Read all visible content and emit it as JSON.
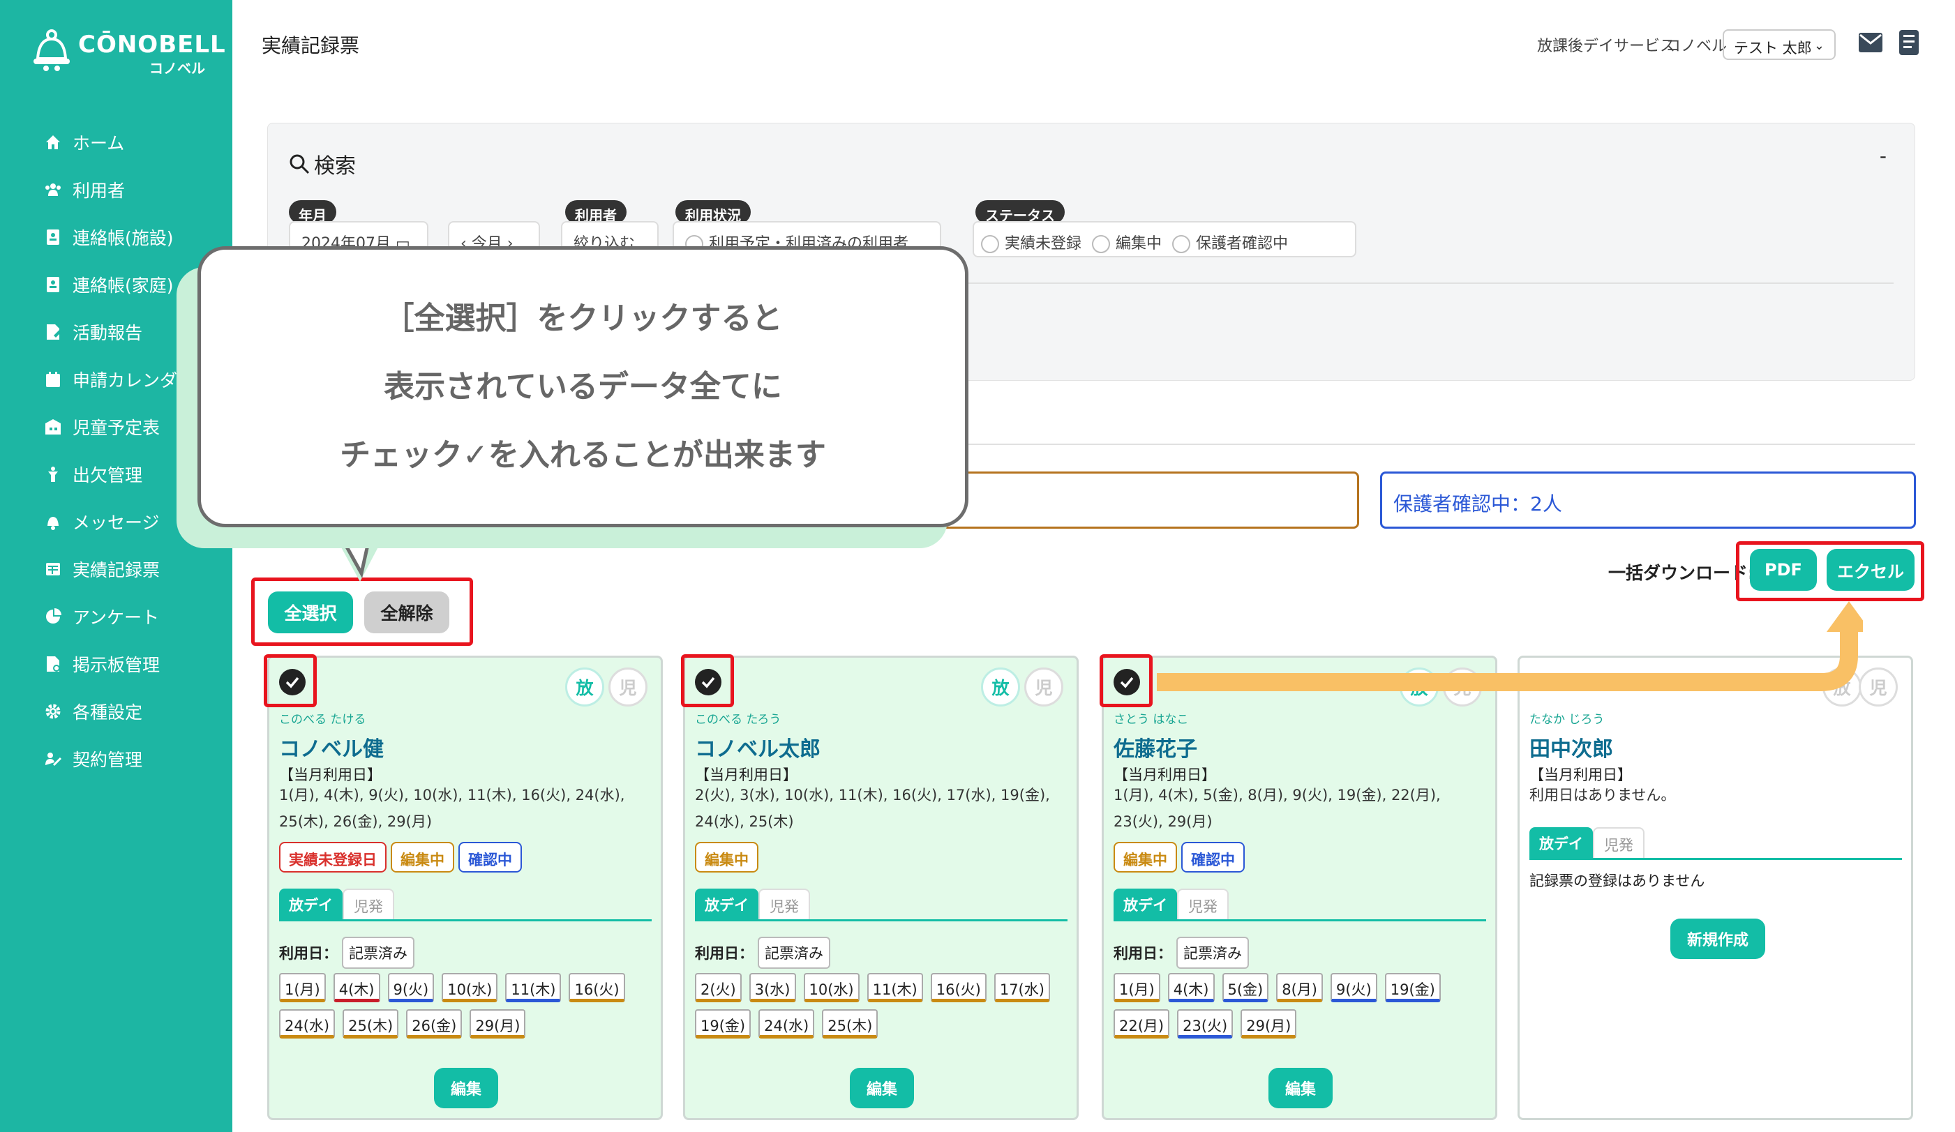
{
  "brand": {
    "name": "CŌNOBELL",
    "sub": "コノベル"
  },
  "sidebar": {
    "items": [
      {
        "label": "ホーム",
        "icon": "home-icon"
      },
      {
        "label": "利用者",
        "icon": "users-icon"
      },
      {
        "label": "連絡帳(施設)",
        "icon": "contact-book-icon"
      },
      {
        "label": "連絡帳(家庭)",
        "icon": "contact-book-icon"
      },
      {
        "label": "活動報告",
        "icon": "report-icon"
      },
      {
        "label": "申請カレンダー",
        "icon": "calendar-icon"
      },
      {
        "label": "児童予定表",
        "icon": "schedule-icon"
      },
      {
        "label": "出欠管理",
        "icon": "attendance-icon"
      },
      {
        "label": "メッセージ",
        "icon": "bell-icon"
      },
      {
        "label": "実績記録票",
        "icon": "table-icon"
      },
      {
        "label": "アンケート",
        "icon": "pie-icon"
      },
      {
        "label": "掲示板管理",
        "icon": "board-icon"
      },
      {
        "label": "各種設定",
        "icon": "gear-icon"
      },
      {
        "label": "契約管理",
        "icon": "contract-icon"
      }
    ]
  },
  "header": {
    "title": "実績記録票",
    "service": "放課後デイサービス",
    "facility": "コノベル",
    "user": "テスト 太郎"
  },
  "search": {
    "title": "検索",
    "collapse": "-",
    "year_month_label": "年月",
    "year_month_value": "2024年07月",
    "month_nav": "今月",
    "user_label": "利用者",
    "user_value": "絞り込む",
    "usage_label": "利用状況",
    "usage_value": "利用予定・利用済みの利用者",
    "status_label": "ステータス",
    "status_options": [
      "実績未登録",
      "編集中",
      "保護者確認中"
    ]
  },
  "status_summary": {
    "confirm": "保護者確認中：2人"
  },
  "download": {
    "label": "一括ダウンロード:",
    "pdf": "PDF",
    "excel": "エクセル"
  },
  "select": {
    "all": "全選択",
    "none": "全解除"
  },
  "callout": {
    "lines": [
      "［全選択］をクリックすると",
      "表示されているデータ全てに",
      "チェック✓を入れることが出来ます"
    ]
  },
  "common": {
    "badge_hou": "放",
    "badge_ji": "児",
    "usage_label": "【当月利用日】",
    "tab_hou": "放デイ",
    "tab_ji": "児発",
    "use_date": "利用日：",
    "recorded": "記票済み",
    "edit": "編集",
    "new": "新規作成"
  },
  "cards": [
    {
      "kana": "このべる たける",
      "name": "コノベル健",
      "days_text": "1(月), 4(木), 9(火), 10(水), 11(木), 16(火), 24(水), 25(木), 26(金), 29(月)",
      "tags": [
        {
          "label": "実績未登録日",
          "color": "#d9302c"
        },
        {
          "label": "編集中",
          "color": "#c98a12"
        },
        {
          "label": "確認中",
          "color": "#2b58d6"
        }
      ],
      "days": [
        {
          "label": "1(月)",
          "color": "#c98a12"
        },
        {
          "label": "4(木)",
          "color": "#c81e2a"
        },
        {
          "label": "9(火)",
          "color": "#2b58d6"
        },
        {
          "label": "10(水)",
          "color": "#c98a12"
        },
        {
          "label": "11(木)",
          "color": "#2b58d6"
        },
        {
          "label": "16(火)",
          "color": "#c98a12"
        },
        {
          "label": "24(水)",
          "color": "#c98a12"
        },
        {
          "label": "25(木)",
          "color": "#c98a12"
        },
        {
          "label": "26(金)",
          "color": "#c98a12"
        },
        {
          "label": "29(月)",
          "color": "#c98a12"
        }
      ]
    },
    {
      "kana": "このべる たろう",
      "name": "コノベル太郎",
      "days_text": "2(火), 3(水), 10(水), 11(木), 16(火), 17(水), 19(金), 24(水), 25(木)",
      "tags": [
        {
          "label": "編集中",
          "color": "#c98a12"
        }
      ],
      "days": [
        {
          "label": "2(火)",
          "color": "#c98a12"
        },
        {
          "label": "3(水)",
          "color": "#c98a12"
        },
        {
          "label": "10(水)",
          "color": "#c98a12"
        },
        {
          "label": "11(木)",
          "color": "#c98a12"
        },
        {
          "label": "16(火)",
          "color": "#c98a12"
        },
        {
          "label": "17(水)",
          "color": "#c98a12"
        },
        {
          "label": "19(金)",
          "color": "#c98a12"
        },
        {
          "label": "24(水)",
          "color": "#c98a12"
        },
        {
          "label": "25(木)",
          "color": "#c98a12"
        }
      ]
    },
    {
      "kana": "さとう はなこ",
      "name": "佐藤花子",
      "days_text": "1(月), 4(木), 5(金), 8(月), 9(火), 19(金), 22(月), 23(火), 29(月)",
      "tags": [
        {
          "label": "編集中",
          "color": "#c98a12"
        },
        {
          "label": "確認中",
          "color": "#2b58d6"
        }
      ],
      "days": [
        {
          "label": "1(月)",
          "color": "#c98a12"
        },
        {
          "label": "4(木)",
          "color": "#2b58d6"
        },
        {
          "label": "5(金)",
          "color": "#2b58d6"
        },
        {
          "label": "8(月)",
          "color": "#c98a12"
        },
        {
          "label": "9(火)",
          "color": "#2b58d6"
        },
        {
          "label": "19(金)",
          "color": "#2b58d6"
        },
        {
          "label": "22(月)",
          "color": "#c98a12"
        },
        {
          "label": "23(火)",
          "color": "#2b58d6"
        },
        {
          "label": "29(月)",
          "color": "#c98a12"
        }
      ]
    },
    {
      "kana": "たなか じろう",
      "name": "田中次郎",
      "days_text": "利用日はありません。",
      "empty": "記録票の登録はありません"
    }
  ]
}
